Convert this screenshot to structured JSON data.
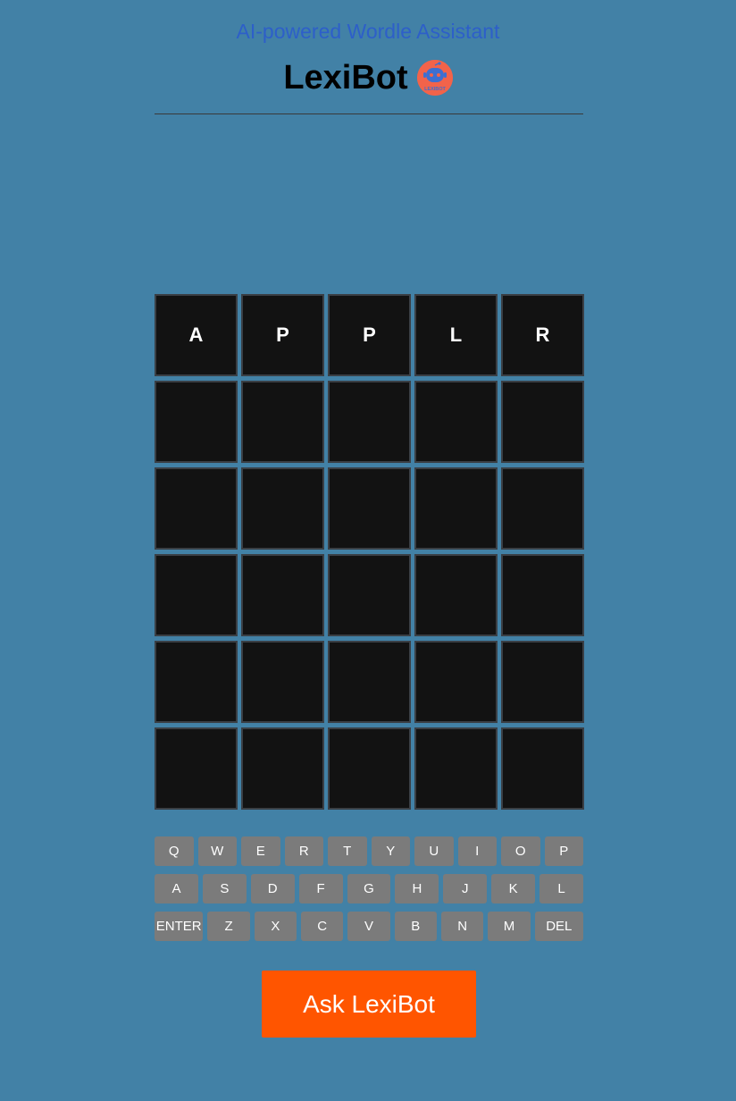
{
  "header": {
    "subtitle": "AI-powered Wordle Assistant",
    "title": "LexiBot",
    "logo_icon": "robot-logo-icon",
    "logo_text": "LEXIBOT",
    "brand_color": "#f2634a"
  },
  "board": {
    "rows": [
      [
        "A",
        "P",
        "P",
        "L",
        "R"
      ],
      [
        "",
        "",
        "",
        "",
        ""
      ],
      [
        "",
        "",
        "",
        "",
        ""
      ],
      [
        "",
        "",
        "",
        "",
        ""
      ],
      [
        "",
        "",
        "",
        "",
        ""
      ],
      [
        "",
        "",
        "",
        "",
        ""
      ]
    ]
  },
  "keyboard": {
    "rows": [
      [
        "Q",
        "W",
        "E",
        "R",
        "T",
        "Y",
        "U",
        "I",
        "O",
        "P"
      ],
      [
        "A",
        "S",
        "D",
        "F",
        "G",
        "H",
        "J",
        "K",
        "L"
      ],
      [
        "ENTER",
        "Z",
        "X",
        "C",
        "V",
        "B",
        "N",
        "M",
        "DEL"
      ]
    ]
  },
  "ask_button": {
    "label": "Ask LexiBot",
    "color": "#ff5500"
  },
  "colors": {
    "background": "#4281a6",
    "tile": "#121212",
    "key": "#7b7b7b"
  }
}
